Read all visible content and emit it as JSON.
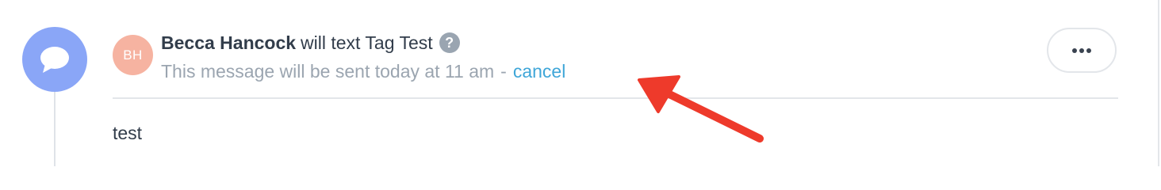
{
  "timeline": {
    "icon": "chat-bubble-icon",
    "color": "#8aa6f7"
  },
  "event": {
    "avatar_initials": "BH",
    "avatar_color": "#f6b3a1",
    "author_name": "Becca Hancock",
    "action_text": "will text Tag Test",
    "help_icon": "question-circle-icon",
    "help_icon_glyph": "?",
    "status_text": "This message will be sent today at 11 am",
    "separator": "-",
    "cancel_label": "cancel",
    "message_body": "test"
  },
  "menu": {
    "icon": "ellipsis-icon"
  },
  "annotation": {
    "icon": "red-arrow",
    "color": "#ee3a2b"
  },
  "colors": {
    "text_primary": "#323d4b",
    "text_secondary": "#9ba5b0",
    "link": "#3fa6d8",
    "border": "#e3e6ea"
  }
}
